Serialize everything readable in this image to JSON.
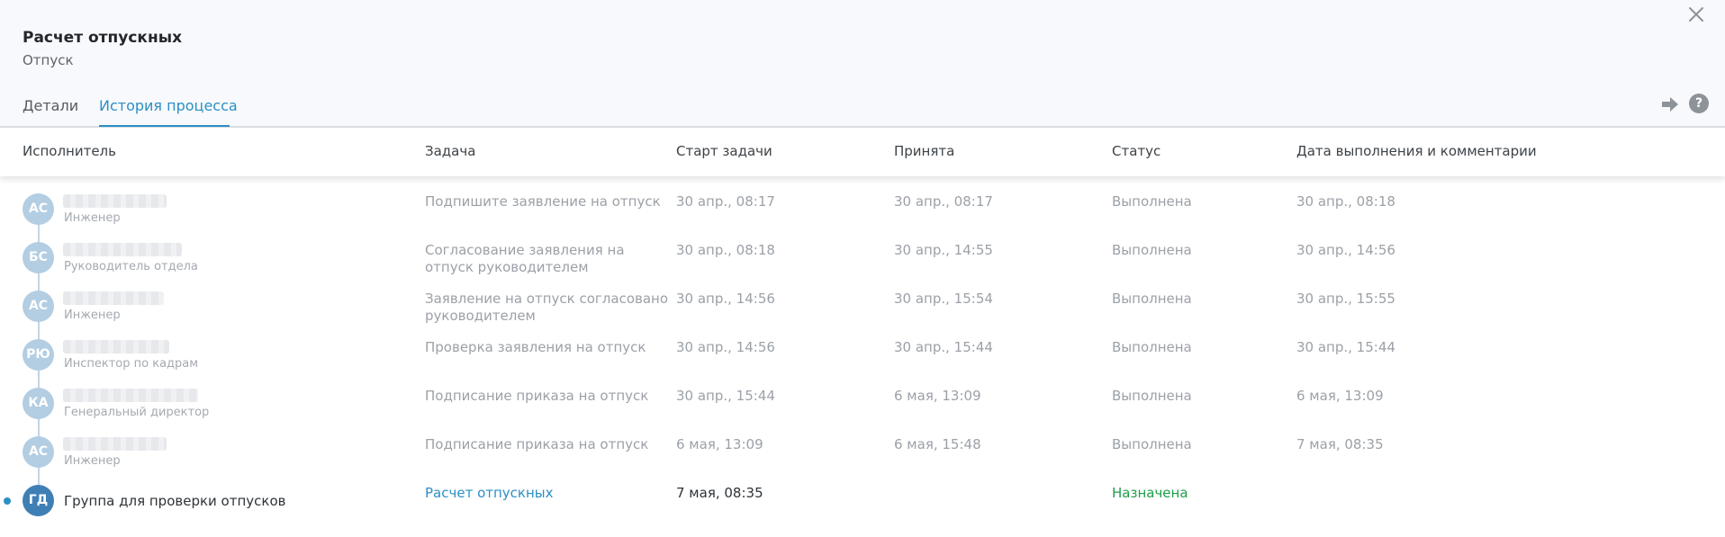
{
  "header": {
    "title": "Расчет отпускных",
    "subtitle": "Отпуск"
  },
  "tabs": [
    {
      "label": "Детали",
      "active": false
    },
    {
      "label": "История процесса",
      "active": true
    }
  ],
  "columns": {
    "executor": "Исполнитель",
    "task": "Задача",
    "start": "Старт задачи",
    "accepted": "Принята",
    "status": "Статус",
    "done": "Дата выполнения и комментарии"
  },
  "rows": [
    {
      "initials": "АС",
      "role": "Инженер",
      "task": "Подпишите заявление на отпуск",
      "start": "30 апр., 08:17",
      "accepted": "30 апр., 08:17",
      "status": "Выполнена",
      "done": "30 апр., 08:18"
    },
    {
      "initials": "БС",
      "role": "Руководитель отдела",
      "task": "Согласование заявления на отпуск руководителем",
      "start": "30 апр., 08:18",
      "accepted": "30 апр., 14:55",
      "status": "Выполнена",
      "done": "30 апр., 14:56"
    },
    {
      "initials": "АС",
      "role": "Инженер",
      "task": "Заявление на отпуск согласовано руководителем",
      "start": "30 апр., 14:56",
      "accepted": "30 апр., 15:54",
      "status": "Выполнена",
      "done": "30 апр., 15:55"
    },
    {
      "initials": "РЮ",
      "role": "Инспектор по кадрам",
      "task": "Проверка заявления на отпуск",
      "start": "30 апр., 14:56",
      "accepted": "30 апр., 15:44",
      "status": "Выполнена",
      "done": "30 апр., 15:44"
    },
    {
      "initials": "КА",
      "role": "Генеральный директор",
      "task": "Подписание приказа на отпуск",
      "start": "30 апр., 15:44",
      "accepted": "6 мая, 13:09",
      "status": "Выполнена",
      "done": "6 мая, 13:09"
    },
    {
      "initials": "АС",
      "role": "Инженер",
      "task": "Подписание приказа на отпуск",
      "start": "6 мая, 13:09",
      "accepted": "6 мая, 15:48",
      "status": "Выполнена",
      "done": "7 мая, 08:35"
    }
  ],
  "current": {
    "initials": "ГД",
    "name": "Группа для проверки отпусков",
    "task": "Расчет отпускных",
    "start": "7 мая, 08:35",
    "status": "Назначена"
  },
  "icons": {
    "close": "close-icon",
    "forward": "arrow-right-icon",
    "help": "help-icon"
  },
  "colors": {
    "accent": "#2b8fc4",
    "status_assigned": "#1f9e4c",
    "avatar_done": "#b3cde2",
    "avatar_active": "#3f7fb5"
  }
}
